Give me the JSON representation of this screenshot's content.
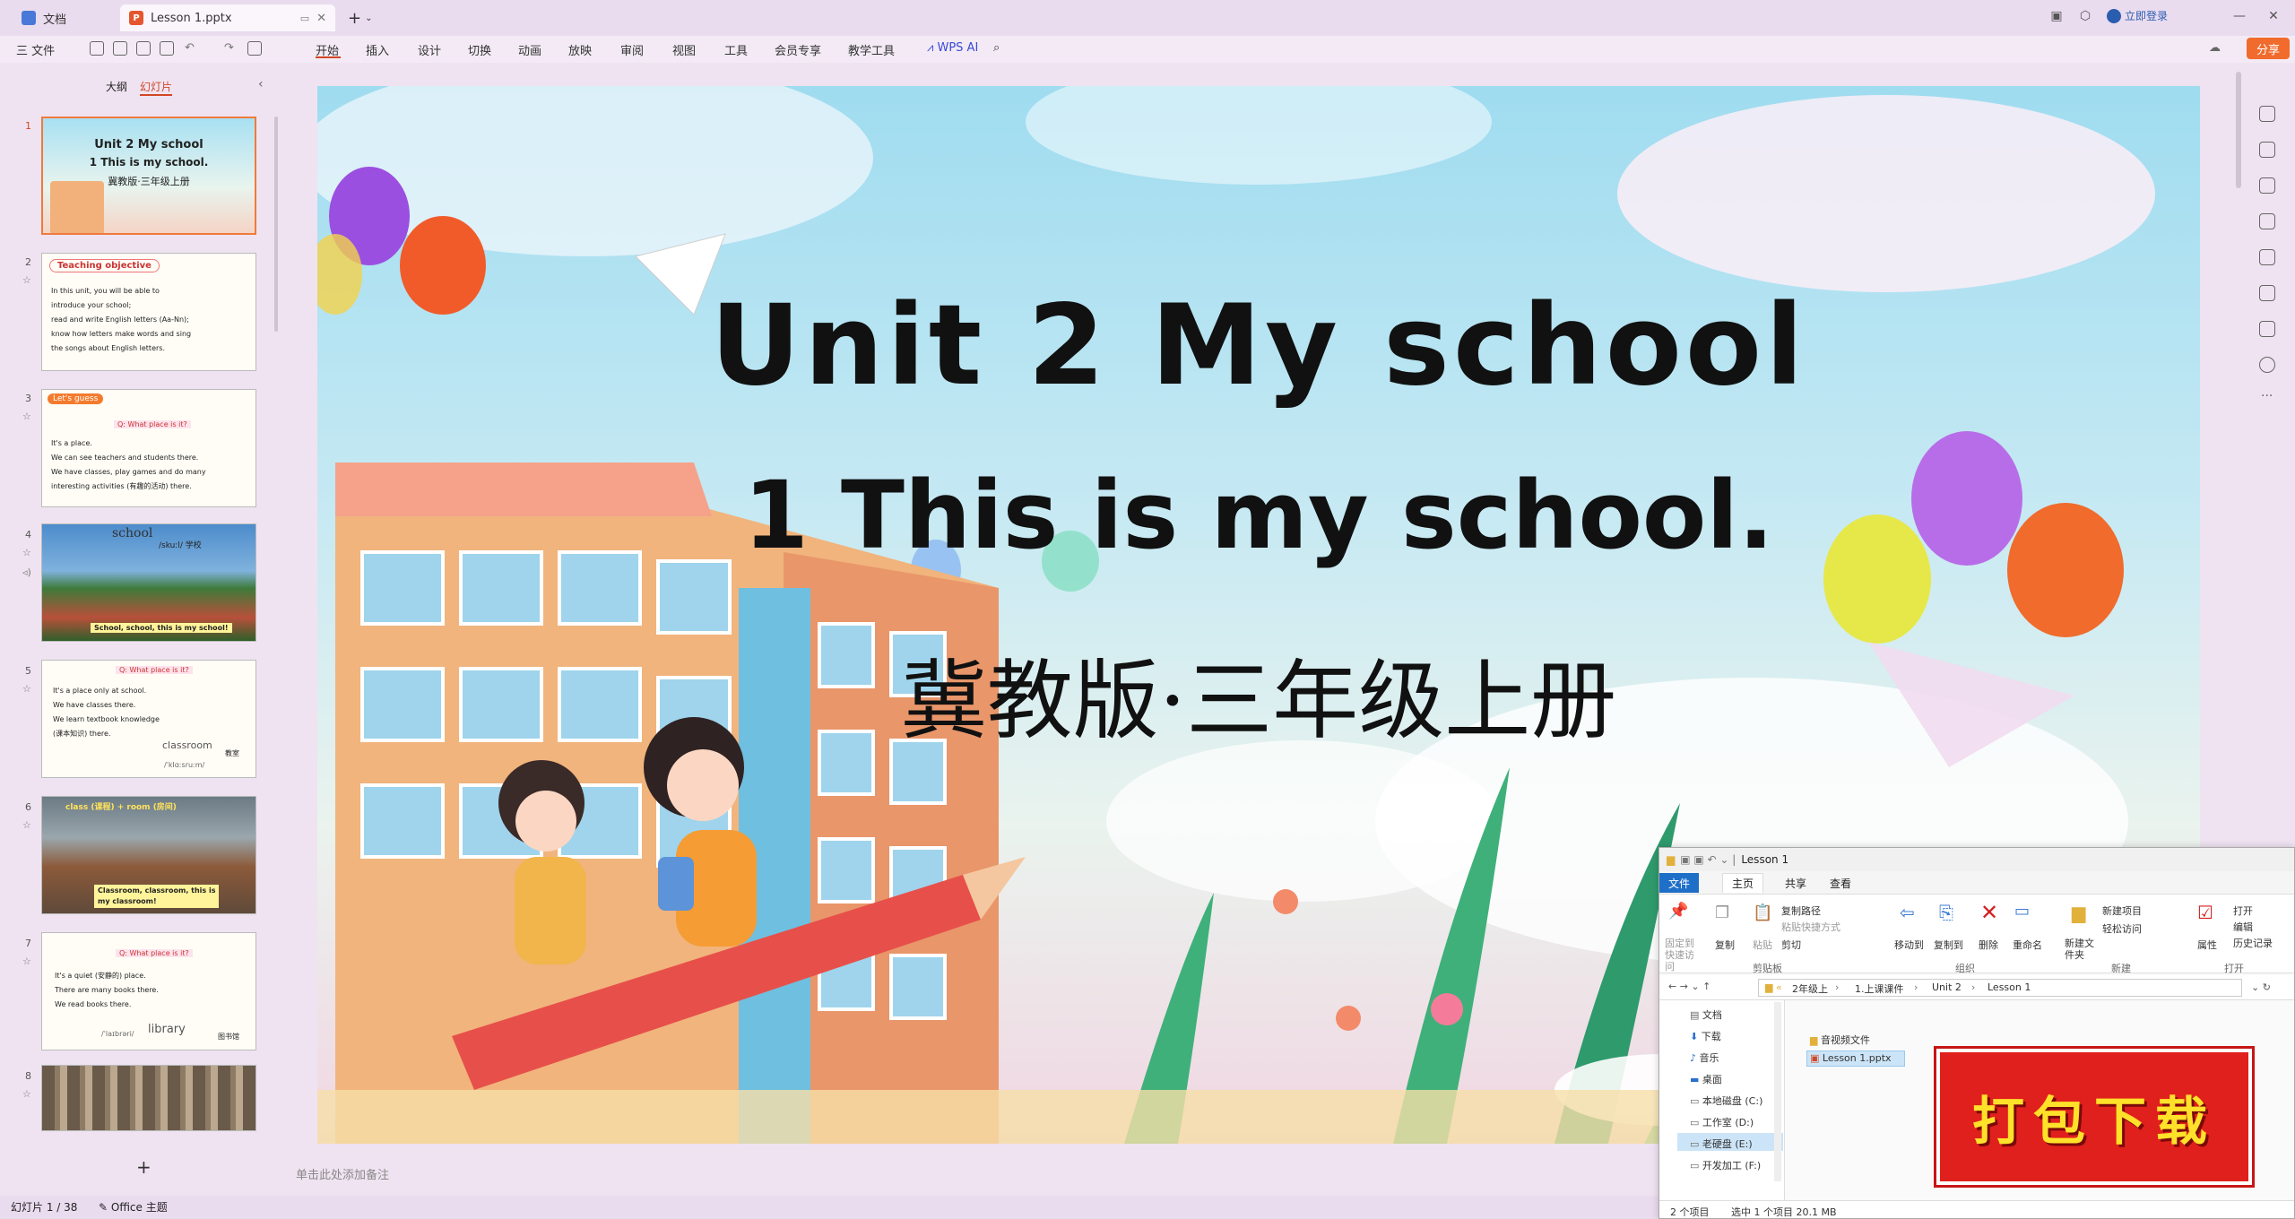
{
  "tabs": [
    {
      "label": "文档"
    },
    {
      "label": "Lesson 1.pptx"
    }
  ],
  "window": {
    "login": "立即登录",
    "new_tab": "+"
  },
  "menu": {
    "file": "三 文件",
    "items": [
      "开始",
      "插入",
      "设计",
      "切换",
      "动画",
      "放映",
      "审阅",
      "视图",
      "工具",
      "会员专享",
      "教学工具"
    ],
    "wps_ai": "WPS AI",
    "share": "分享"
  },
  "panel": {
    "outline_tab": "大纲",
    "slides_tab": "幻灯片",
    "add": "+"
  },
  "thumbnails": [
    {
      "num": "1",
      "lines": [
        "Unit 2 My school",
        "1 This is my school.",
        "冀教版·三年级上册"
      ]
    },
    {
      "num": "2",
      "lines": [
        "Teaching objective",
        "In this unit, you will be able to",
        "introduce your school;",
        "read and write English letters (Aa-Nn);",
        "know how letters make words and sing",
        "the songs about English letters."
      ]
    },
    {
      "num": "3",
      "lines": [
        "Let's guess",
        "Q: What place is it?",
        "It's a place.",
        "We can see teachers and students there.",
        "We have classes, play games and do many",
        "interesting activities (有趣的活动) there."
      ]
    },
    {
      "num": "4",
      "lines": [
        "school",
        "/skuːl/ 学校",
        "School, school, this is my school!"
      ]
    },
    {
      "num": "5",
      "lines": [
        "Q: What place is it?",
        "It's a place only at school.",
        "We have classes there.",
        "We learn textbook knowledge",
        "(课本知识) there.",
        "classroom",
        "教室",
        "/ˈklɑːsruːm/"
      ]
    },
    {
      "num": "6",
      "lines": [
        "class (课程) + room (房间)",
        "Classroom, classroom, this is",
        "my classroom!"
      ]
    },
    {
      "num": "7",
      "lines": [
        "Q: What place is it?",
        "It's a quiet (安静的) place.",
        "There are many books there.",
        "We read books there.",
        "library",
        "图书馆",
        "/ˈlaɪbrəri/"
      ]
    },
    {
      "num": "8",
      "lines": []
    }
  ],
  "slide": {
    "title": "Unit  2  My  school",
    "subtitle": "1 This is my school.",
    "edition": "冀教版·三年级上册"
  },
  "notes_placeholder": "单击此处添加备注",
  "status": {
    "slide_counter": "幻灯片 1 / 38",
    "theme": "Office 主题"
  },
  "explorer": {
    "title": "Lesson 1",
    "ribbon_tabs": [
      "文件",
      "主页",
      "共享",
      "查看"
    ],
    "clipboard_buttons": [
      "固定到快速访问",
      "复制",
      "粘贴"
    ],
    "clipboard_small": [
      "复制路径",
      "粘贴快捷方式",
      "剪切"
    ],
    "group_clipboard": "剪贴板",
    "organize_buttons": [
      "移动到",
      "复制到",
      "删除",
      "重命名"
    ],
    "group_organize": "组织",
    "new_buttons": [
      "新建文件夹"
    ],
    "new_small": [
      "新建项目",
      "轻松访问"
    ],
    "group_new": "新建",
    "open_buttons": [
      "属性"
    ],
    "open_small": [
      "打开",
      "编辑",
      "历史记录"
    ],
    "group_open": "打开",
    "path": [
      "2年级上",
      "1.上课课件",
      "Unit 2",
      "Lesson 1"
    ],
    "nav_items": [
      "文档",
      "下载",
      "音乐",
      "桌面",
      "本地磁盘 (C:)",
      "工作室 (D:)",
      "老硬盘 (E:)",
      "开发加工 (F:)"
    ],
    "files": [
      "音视频文件",
      "Lesson 1.pptx"
    ],
    "status_items": "2 个项目",
    "status_selected": "选中 1 个项目  20.1 MB"
  },
  "download_badge": "打包下载"
}
